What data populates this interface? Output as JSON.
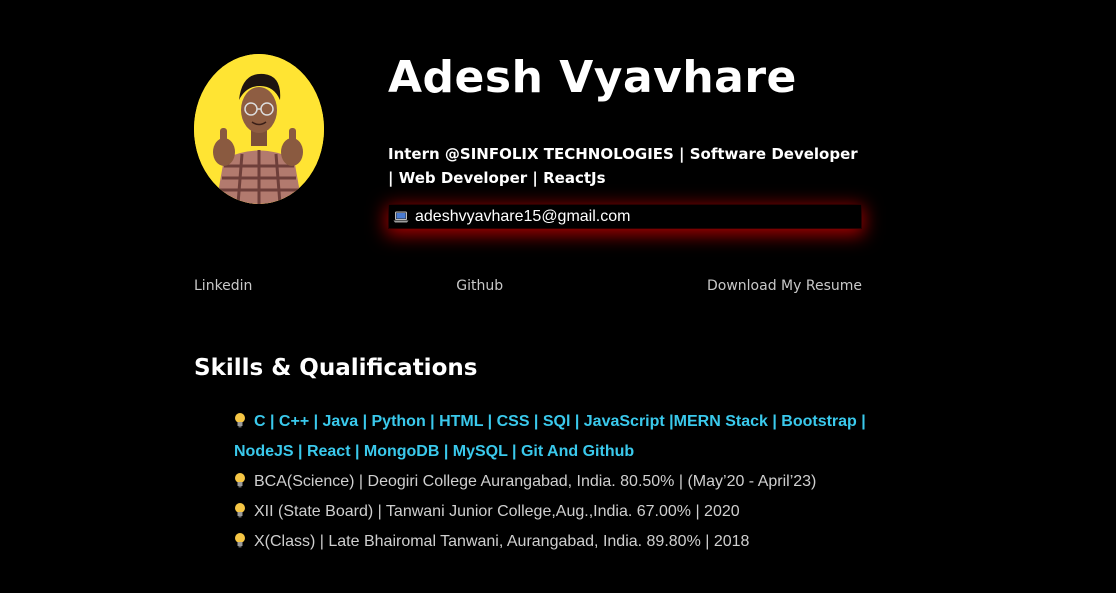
{
  "profile": {
    "name": "Adesh Vyavhare",
    "headline": "Intern @SINFOLIX TECHNOLOGIES | Software Developer | Web Developer | ReactJs",
    "email": "adeshvyavhare15@gmail.com",
    "email_icon": "laptop-icon",
    "avatar_background": "#ffe433"
  },
  "links": {
    "linkedin": "Linkedin",
    "github": "Github",
    "resume": "Download My Resume"
  },
  "skills_section": {
    "title": "Skills & Qualifications",
    "bullet_icon": "lightbulb-icon",
    "items": [
      "C | C++ | Java | Python | HTML | CSS | SQl | JavaScript |MERN Stack | Bootstrap | NodeJS | React | MongoDB | MySQL | Git And Github",
      "BCA(Science) | Deogiri College Aurangabad, India.   80.50% | (May’20 - April’23)",
      "XII (State Board) | Tanwani Junior College,Aug.,India.   67.00% | 2020",
      "X(Class) | Late Bhairomal Tanwani, Aurangabad, India.   89.80% | 2018"
    ]
  },
  "colors": {
    "background": "#000000",
    "skills_accent": "#3ac9ec",
    "email_glow": "#dc0000",
    "text": "#ffffff",
    "muted_text": "#c8c8c8"
  }
}
